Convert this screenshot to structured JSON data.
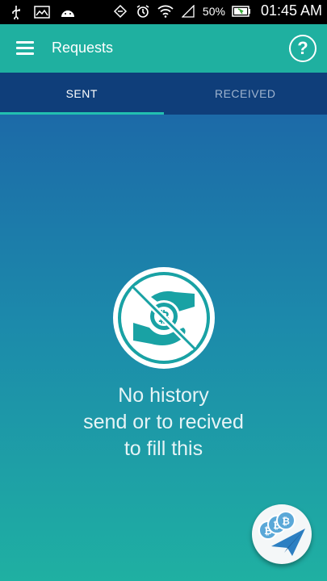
{
  "status_bar": {
    "battery_percent": "50%",
    "time": "01:45 AM",
    "icons_left": [
      "usb-icon",
      "image-icon",
      "android-icon"
    ],
    "icons_right": [
      "data-sync-icon",
      "alarm-icon",
      "wifi-icon",
      "signal-icon",
      "battery-icon"
    ]
  },
  "app_bar": {
    "title": "Requests",
    "help_label": "?"
  },
  "tabs": [
    {
      "label": "SENT",
      "active": true
    },
    {
      "label": "RECEIVED",
      "active": false
    }
  ],
  "empty_state": {
    "line1": "No history",
    "line2": "send or to recived",
    "line3": "to fill this"
  },
  "colors": {
    "app_bar": "#1fb0a0",
    "tab_bar": "#0f3e7a",
    "tab_indicator": "#22c0b0",
    "content_top": "#1c6aa8",
    "content_bottom": "#1fb0a2"
  }
}
